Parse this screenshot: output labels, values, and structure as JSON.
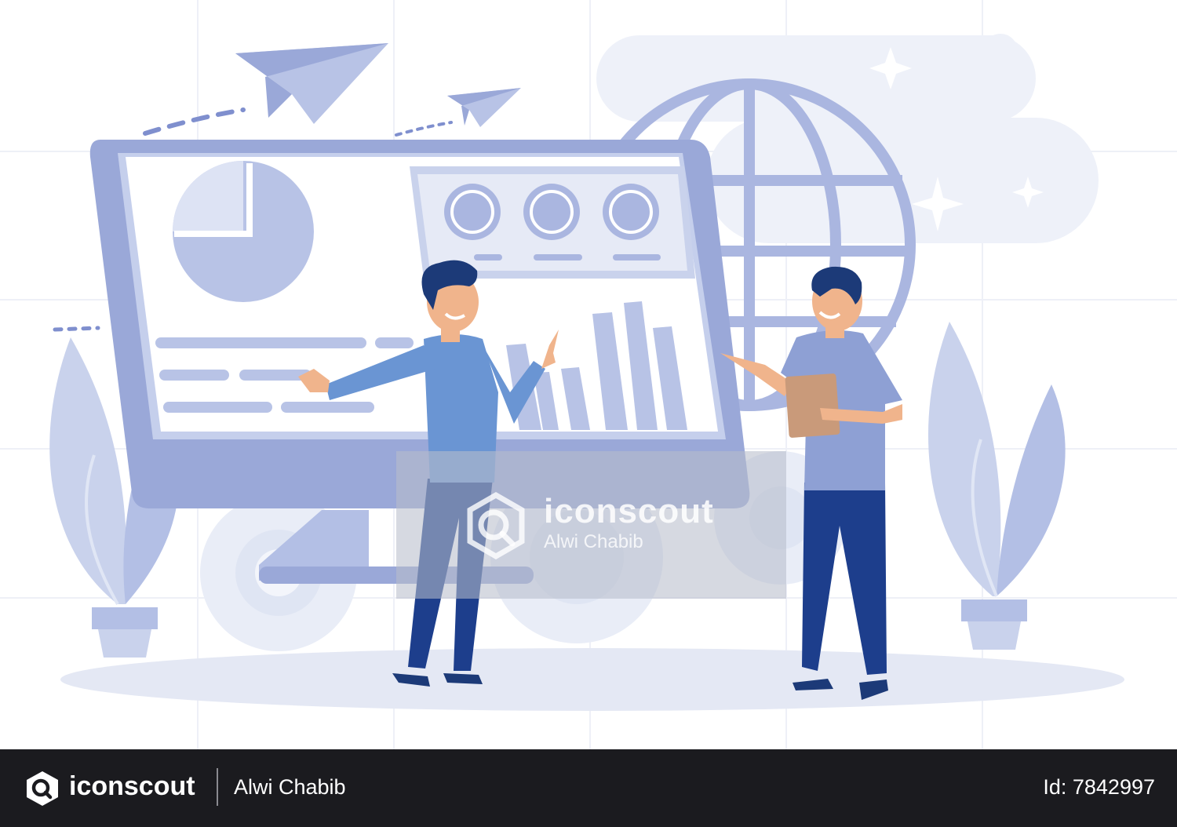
{
  "watermark": {
    "brand": "iconscout",
    "author": "Alwi Chabib"
  },
  "footer": {
    "brand": "iconscout",
    "author": "Alwi Chabib",
    "asset_id": "Id: 7842997"
  },
  "colors": {
    "primary_light": "#c9d2ec",
    "primary_mid": "#9aa8d8",
    "primary_dark": "#1d3e8c",
    "shirt_blue": "#6a95d3",
    "skin": "#f0b48c",
    "hair": "#1c3a78",
    "footer_bg": "#1b1b1f"
  },
  "icons": [
    "paper-plane-icon",
    "globe-icon",
    "pie-chart-icon",
    "bar-chart-icon",
    "gear-icon",
    "sparkle-icon",
    "iconscout-logo-icon"
  ]
}
